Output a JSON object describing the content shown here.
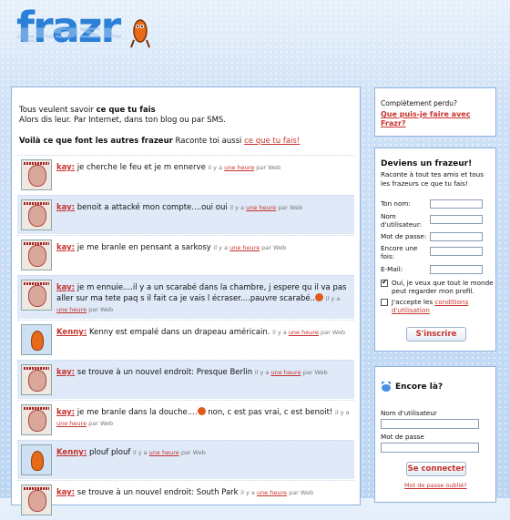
{
  "logo": {
    "text": "frazr"
  },
  "intro": {
    "line1_prefix": "Tous veulent savoir ",
    "line1_bold": "ce que tu fais",
    "line2": "Alors dis leur. Par Internet, dans ton blog ou par SMS."
  },
  "voila": {
    "bold": "Voilà ce que font les autres frazeur",
    "text": " Raconte toi aussi ",
    "link": "ce que tu fais!"
  },
  "feed": [
    {
      "author": "kay:",
      "avatar": "kay",
      "text": " je cherche le feu et je m ennerve ",
      "emoji": false,
      "text2": "",
      "ago_prefix": "il y a ",
      "ago_link": "une heure",
      "via": " par Web",
      "alt": false
    },
    {
      "author": "kay:",
      "avatar": "kay",
      "text": " benoit a attacké mon compte....oui oui ",
      "emoji": false,
      "text2": "",
      "ago_prefix": "il y a ",
      "ago_link": "une heure",
      "via": " par Web",
      "alt": true
    },
    {
      "author": "kay:",
      "avatar": "kay",
      "text": " je me branle en pensant a sarkosy ",
      "emoji": false,
      "text2": "",
      "ago_prefix": "il y a ",
      "ago_link": "une heure",
      "via": " par Web",
      "alt": false
    },
    {
      "author": "kay:",
      "avatar": "kay",
      "text": " je m ennuie....il y a un scarabé dans la chambre, j espere qu il va pas aller sur ma tete paq s il fait ca je vais l écraser....pauvre scarabé..",
      "emoji": true,
      "text2": " ",
      "ago_prefix": "il y a ",
      "ago_link": "une heure",
      "via": " par Web",
      "alt": true
    },
    {
      "author": "Kenny:",
      "avatar": "kenny",
      "text": " Kenny est empalé dans un drapeau américain. ",
      "emoji": false,
      "text2": "",
      "ago_prefix": "il y a ",
      "ago_link": "une heure",
      "via": " par Web",
      "alt": false
    },
    {
      "author": "kay:",
      "avatar": "kay",
      "text": " se trouve à un nouvel endroit: Presque Berlin ",
      "emoji": false,
      "text2": "",
      "ago_prefix": "il y a ",
      "ago_link": "une heure",
      "via": " par Web",
      "alt": true
    },
    {
      "author": "kay:",
      "avatar": "kay",
      "text": " je me branle dans la douche....",
      "emoji": true,
      "text2": " non, c est pas vrai, c est benoit! ",
      "ago_prefix": "il y a ",
      "ago_link": "une heure",
      "via": " par Web",
      "alt": false
    },
    {
      "author": "Kenny:",
      "avatar": "kenny",
      "text": " plouf plouf ",
      "emoji": false,
      "text2": "",
      "ago_prefix": "il y a ",
      "ago_link": "une heure",
      "via": " par Web",
      "alt": true
    },
    {
      "author": "kay:",
      "avatar": "kay",
      "text": " se trouve à un nouvel endroit: South Park ",
      "emoji": false,
      "text2": "",
      "ago_prefix": "il y a ",
      "ago_link": "une heure",
      "via": " par Web",
      "alt": false
    }
  ],
  "help": {
    "question": "Complètement perdu?",
    "link": "Que puis-je faire avec Frazr?"
  },
  "signup": {
    "title": "Deviens un frazeur!",
    "subtitle": "Raconte à tout tes amis et tous les frazeurs ce que tu fais!",
    "fields": {
      "name": "Ton nom:",
      "username": "Nom d'utilisateur:",
      "password": "Mot de passe:",
      "password2": "Encore une fois:",
      "email": "E-Mail:"
    },
    "public_check": "Oui, je veux que tout le monde peut regarder mon profil.",
    "accept_prefix": "J'accepte les ",
    "accept_link": "conditions d'utilisation",
    "button": "S'inscrire"
  },
  "login": {
    "title": "Encore là?",
    "username_label": "Nom d'utilisateur",
    "password_label": "Mot de passe",
    "button": "Se connecter",
    "forgot": "Mot de passe oublié?"
  }
}
